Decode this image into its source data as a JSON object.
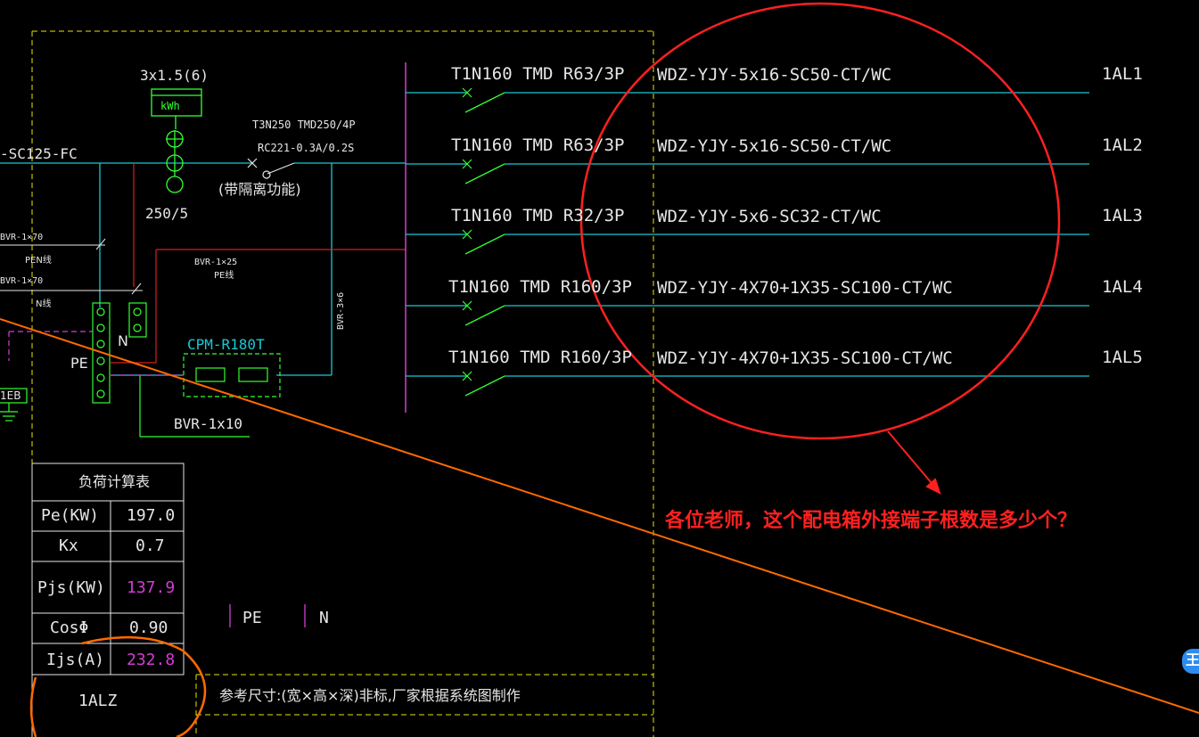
{
  "colors": {
    "background": "#000000",
    "feeder_line": "#19c8d4",
    "breaker": "#33ff33",
    "busbar": "#d43cd4",
    "frame": "#e6e600",
    "annotation": "#ff2020",
    "orange_line": "#ff6a00"
  },
  "incoming": {
    "cable_label": "-SC125-FC",
    "meter_spec": "3x1.5(6)",
    "meter_label": "kWh",
    "ct_ratio": "250/5",
    "main_breaker": "T3N250 TMD250/4P",
    "rcd": "RC221-0.3A/0.2S",
    "isolation_note": "(带隔离功能)"
  },
  "grounding": {
    "pen_cable": "BVR-1×70",
    "pen_label": "PEN线",
    "n_cable": "BVR-1×70",
    "n_label": "N线",
    "pe_cable": "BVR-1×25",
    "pe_label": "PE线",
    "vertical_cable": "BVR-3×6",
    "n_terminal": "N",
    "pe_terminal": "PE",
    "meb_label": "1EB",
    "spd": "CPM-R180T",
    "spd_cable": "BVR-1x10"
  },
  "feeders": [
    {
      "breaker": "T1N160 TMD R63/3P",
      "cable": "WDZ-YJY-5x16-SC50-CT/WC",
      "circuit": "1AL1"
    },
    {
      "breaker": "T1N160 TMD R63/3P",
      "cable": "WDZ-YJY-5x16-SC50-CT/WC",
      "circuit": "1AL2"
    },
    {
      "breaker": "T1N160 TMD R32/3P",
      "cable": "WDZ-YJY-5x6-SC32-CT/WC",
      "circuit": "1AL3"
    },
    {
      "breaker": "T1N160 TMD R160/3P",
      "cable": "WDZ-YJY-4X70+1X35-SC100-CT/WC",
      "circuit": "1AL4"
    },
    {
      "breaker": "T1N160 TMD R160/3P",
      "cable": "WDZ-YJY-4X70+1X35-SC100-CT/WC",
      "circuit": "1AL5"
    }
  ],
  "load_table": {
    "title": "负荷计算表",
    "rows": [
      {
        "label": "Pe(KW)",
        "value": "197.0"
      },
      {
        "label": "Kx",
        "value": "0.7"
      },
      {
        "label": "Pjs(KW)",
        "value": "137.9"
      },
      {
        "label": "CosΦ",
        "value": "0.90"
      },
      {
        "label": "Ijs(A)",
        "value": "232.8"
      }
    ]
  },
  "bottom_bars": {
    "pe": "PE",
    "n": "N"
  },
  "panel_name": "1ALZ",
  "size_note": "参考尺寸:(宽×高×深)非标,厂家根据系统图制作",
  "question": "各位老师，这个配电箱外接端子根数是多少个？",
  "side_badge": "王"
}
